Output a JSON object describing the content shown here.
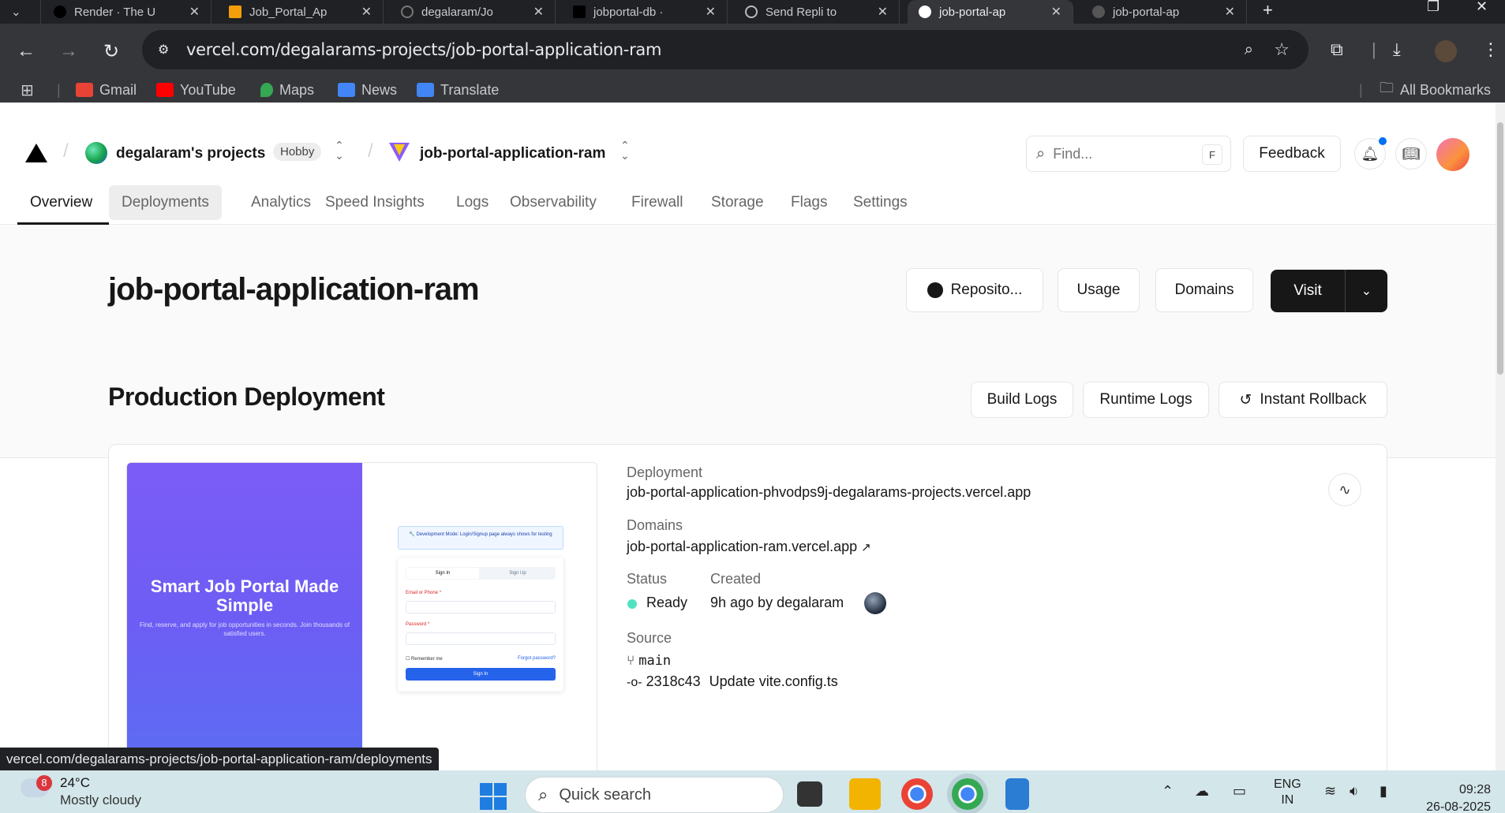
{
  "browser": {
    "tabs": [
      {
        "title": "Render · The U"
      },
      {
        "title": "Job_Portal_Ap"
      },
      {
        "title": "degalaram/Jo"
      },
      {
        "title": "jobportal-db ·"
      },
      {
        "title": "Send Repli to"
      },
      {
        "title": "job-portal-ap",
        "active": true
      },
      {
        "title": "job-portal-ap"
      }
    ],
    "url": "vercel.com/degalarams-projects/job-portal-application-ram",
    "bookmarks": [
      {
        "label": "Gmail",
        "icon": "gmail-icon",
        "color": "#ea4335"
      },
      {
        "label": "YouTube",
        "icon": "youtube-icon",
        "color": "#ff0000"
      },
      {
        "label": "Maps",
        "icon": "maps-icon",
        "color": "#34a853"
      },
      {
        "label": "News",
        "icon": "news-icon",
        "color": "#4285f4"
      },
      {
        "label": "Translate",
        "icon": "translate-icon",
        "color": "#4285f4"
      }
    ],
    "all_bookmarks": "All Bookmarks",
    "status_url": "vercel.com/degalarams-projects/job-portal-application-ram/deployments"
  },
  "header": {
    "team": "degalaram's projects",
    "plan": "Hobby",
    "project": "job-portal-application-ram",
    "search_placeholder": "Find...",
    "search_shortcut": "F",
    "feedback": "Feedback"
  },
  "nav": {
    "tabs": [
      "Overview",
      "Deployments",
      "Analytics",
      "Speed Insights",
      "Logs",
      "Observability",
      "Firewall",
      "Storage",
      "Flags",
      "Settings"
    ],
    "active": "Overview",
    "hovered": "Deployments"
  },
  "project_header": {
    "title": "job-portal-application-ram",
    "repository": "Reposito...",
    "usage": "Usage",
    "domains": "Domains",
    "visit": "Visit"
  },
  "production": {
    "title": "Production Deployment",
    "build_logs": "Build Logs",
    "runtime_logs": "Runtime Logs",
    "instant_rollback": "Instant Rollback"
  },
  "deployment": {
    "deployment_label": "Deployment",
    "deployment_url": "job-portal-application-phvodps9j-degalarams-projects.vercel.app",
    "domains_label": "Domains",
    "domain": "job-portal-application-ram.vercel.app",
    "status_label": "Status",
    "status": "Ready",
    "status_color": "#50e3c2",
    "created_label": "Created",
    "created": "9h ago by degalaram",
    "source_label": "Source",
    "branch": "main",
    "commit_hash": "2318c43",
    "commit_message": "Update vite.config.ts"
  },
  "preview": {
    "hero_title": "Smart Job Portal Made Simple",
    "hero_sub": "Find, reserve, and apply for job opportunities in seconds. Join thousands of satisfied users.",
    "dev_notice": "🔧 Development Mode: Login/Signup page always shows for testing",
    "tab_signin": "Sign In",
    "tab_signup": "Sign Up",
    "email_label": "Email or Phone *",
    "password_label": "Password *",
    "remember": "Remember me",
    "forgot": "Forgot password?",
    "signin_button": "Sign In"
  },
  "taskbar": {
    "weather_badge": "8",
    "temperature": "24°C",
    "weather": "Mostly cloudy",
    "search": "Quick search",
    "lang": "ENG",
    "region": "IN",
    "time": "09:28",
    "date": "26-08-2025"
  }
}
